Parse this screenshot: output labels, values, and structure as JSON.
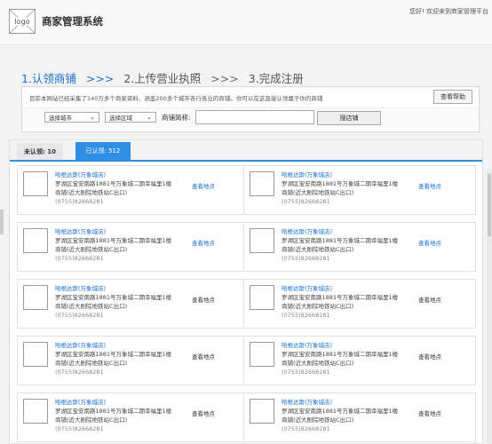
{
  "header": {
    "logo_text": "logo",
    "system_title": "商家管理系统",
    "welcome": "您好! 欢迎来到商家管理平台"
  },
  "steps": {
    "step1": "1.认领商铺",
    "arrow1": ">>>",
    "step2": "2.上传营业执照",
    "arrow2": ">>>",
    "step3": "3.完成注册"
  },
  "search_panel": {
    "notice": "目前本网站已经采集了140万多个商家资料、涵盖200多个城市各行各业的商铺。你可以在这直接认领属于你的商铺",
    "help_button": "查看帮助",
    "city_select": "选择城市",
    "area_select": "选择区域",
    "shop_name_label": "商铺简称:",
    "shop_name_value": "",
    "search_button": "搜店铺"
  },
  "tabs": {
    "unclaimed": "未认领: 10",
    "claimed": "已认领: 512"
  },
  "cards": [
    {
      "name": "哈根达斯(万象城店)",
      "address_line1": "罗湖区宝安南路1881号万象城二期幸福里1楼",
      "address_line2": "商铺(近大剧院地铁站C出口)",
      "phone": "(0755)82668281",
      "action": "查看地点"
    },
    {
      "name": "哈根达斯(万象城店)",
      "address_line1": "罗湖区宝安南路1881号万象城二期幸福里1楼",
      "address_line2": "商铺(近大剧院地铁站C出口)",
      "phone": "(0755)82668281",
      "action": "查看地点"
    },
    {
      "name": "哈根达斯(万象城店)",
      "address_line1": "罗湖区宝安南路1881号万象城二期幸福里1楼",
      "address_line2": "商铺(近大剧院地铁站C出口)",
      "phone": "(0755)82668281",
      "action": "查看地点"
    },
    {
      "name": "哈根达斯(万象城店)",
      "address_line1": "罗湖区宝安南路1881号万象城二期幸福里1楼",
      "address_line2": "商铺(近大剧院地铁站C出口)",
      "phone": "(0755)82668281",
      "action": "查看地点"
    },
    {
      "name": "哈根达斯(万象城店)",
      "address_line1": "罗湖区宝安南路1881号万象城二期幸福里1楼",
      "address_line2": "商铺(近大剧院地铁站C出口)",
      "phone": "(0755)82668281",
      "action": "查看地点"
    },
    {
      "name": "哈根达斯(万象城店)",
      "address_line1": "罗湖区宝安南路1881号万象城二期幸福里1楼",
      "address_line2": "商铺(近大剧院地铁站C出口)",
      "phone": "(0755)82668281",
      "action": "查看地点"
    },
    {
      "name": "哈根达斯(万象城店)",
      "address_line1": "罗湖区宝安南路1881号万象城二期幸福里1楼",
      "address_line2": "商铺(近大剧院地铁站C出口)",
      "phone": "(0755)82668281",
      "action": "查看地点"
    },
    {
      "name": "哈根达斯(万象城店)",
      "address_line1": "罗湖区宝安南路1881号万象城二期幸福里1楼",
      "address_line2": "商铺(近大剧院地铁站C出口)",
      "phone": "(0755)82668281",
      "action": "查看地点"
    },
    {
      "name": "哈根达斯(万象城店)",
      "address_line1": "罗湖区宝安南路1881号万象城二期幸福里1楼",
      "address_line2": "商铺(近大剧院地铁站C出口)",
      "phone": "(0755)82668281",
      "action": "查看地点"
    },
    {
      "name": "哈根达斯(万象城店)",
      "address_line1": "罗湖区宝安南路1881号万象城二期幸福里1楼",
      "address_line2": "商铺(近大剧院地铁站C出口)",
      "phone": "(0755)82668281",
      "action": "查看地点"
    }
  ],
  "colors": {
    "accent": "#1a6fd0",
    "tab_active": "#2f8fe4"
  }
}
